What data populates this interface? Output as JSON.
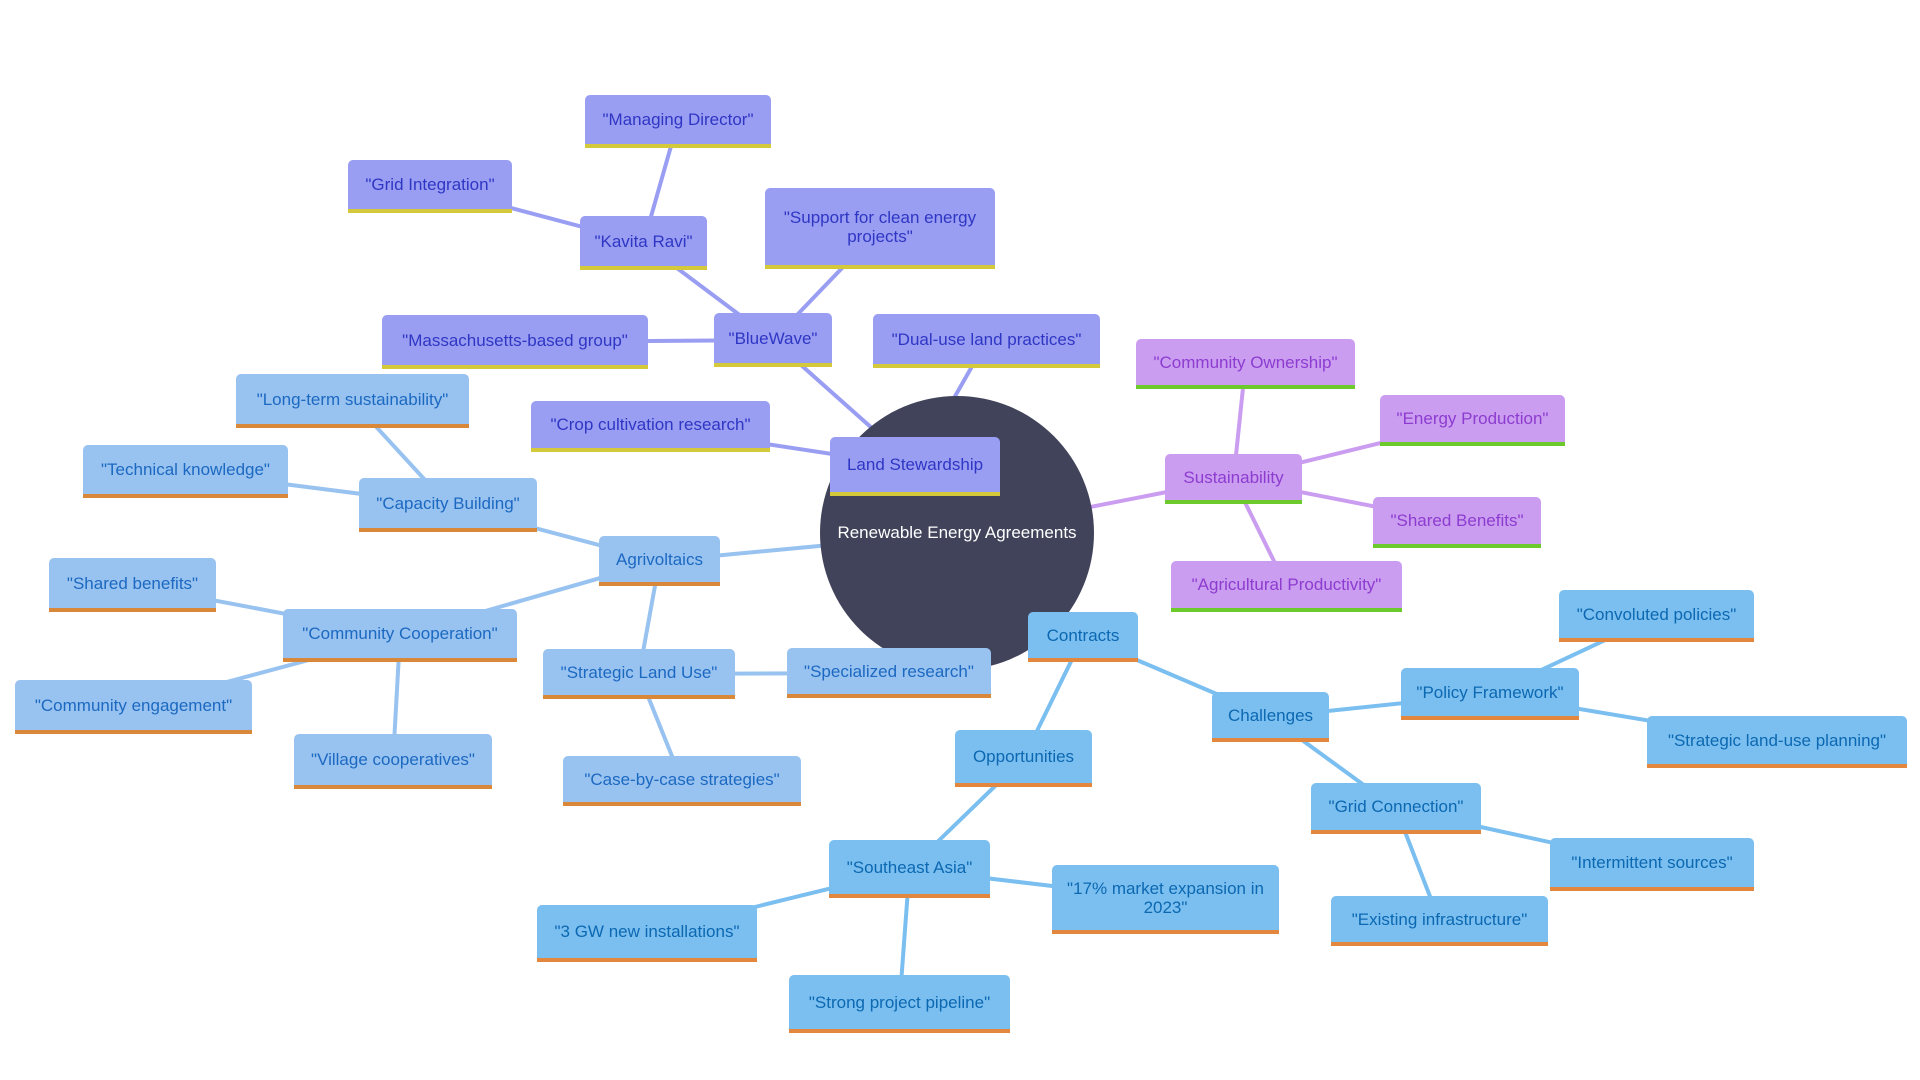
{
  "root": {
    "label": "Renewable Energy Agreements"
  },
  "colors": {
    "root": "#40435a",
    "land_stewardship": "#999ef2",
    "agrivoltaics": "#98c2ef",
    "contracts": "#7abff0",
    "sustainability": "#cb9df1"
  },
  "nodes": {
    "land_stewardship": "Land Stewardship",
    "bluewave": "\"BlueWave\"",
    "kavita_ravi": "\"Kavita Ravi\"",
    "managing_director": "\"Managing Director\"",
    "grid_integration": "\"Grid Integration\"",
    "massachusetts": "\"Massachusetts-based group\"",
    "support_clean": "\"Support for clean energy projects\"",
    "dual_use": "\"Dual-use land practices\"",
    "crop_cultivation": "\"Crop cultivation research\"",
    "agrivoltaics": "Agrivoltaics",
    "capacity_building": "\"Capacity Building\"",
    "long_term": "\"Long-term sustainability\"",
    "technical": "\"Technical knowledge\"",
    "community_cooperation": "\"Community Cooperation\"",
    "shared_benefits_lc": "\"Shared benefits\"",
    "community_engagement": "\"Community engagement\"",
    "village_coops": "\"Village cooperatives\"",
    "strategic_land_use": "\"Strategic Land Use\"",
    "specialized_research": "\"Specialized research\"",
    "case_by_case": "\"Case-by-case strategies\"",
    "sustainability": "Sustainability",
    "community_ownership": "\"Community Ownership\"",
    "energy_production": "\"Energy Production\"",
    "shared_benefits": "\"Shared Benefits\"",
    "agri_productivity": "\"Agricultural Productivity\"",
    "contracts": "Contracts",
    "challenges": "Challenges",
    "policy_framework": "\"Policy Framework\"",
    "convoluted": "\"Convoluted policies\"",
    "strategic_planning": "\"Strategic land-use planning\"",
    "grid_connection": "\"Grid Connection\"",
    "intermittent": "\"Intermittent sources\"",
    "existing_infra": "\"Existing infrastructure\"",
    "opportunities": "Opportunities",
    "southeast_asia": "\"Southeast Asia\"",
    "three_gw": "\"3 GW new installations\"",
    "market_expansion": "\"17% market expansion in 2023\"",
    "strong_pipeline": "\"Strong project pipeline\""
  }
}
